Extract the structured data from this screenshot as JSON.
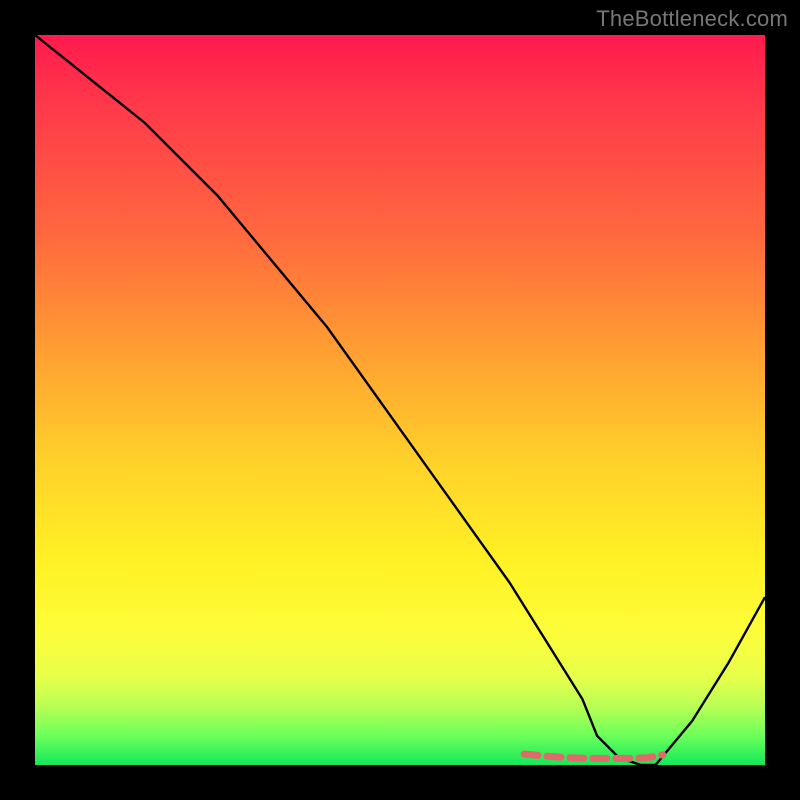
{
  "watermark": "TheBottleneck.com",
  "chart_data": {
    "type": "line",
    "title": "",
    "xlabel": "",
    "ylabel": "",
    "xlim": [
      0,
      100
    ],
    "ylim": [
      0,
      100
    ],
    "series": [
      {
        "name": "black-curve",
        "x": [
          0,
          5,
          10,
          15,
          20,
          25,
          30,
          35,
          40,
          45,
          50,
          55,
          60,
          65,
          70,
          75,
          77,
          80,
          83,
          85,
          90,
          95,
          100
        ],
        "y": [
          100,
          96,
          92,
          88,
          83,
          78,
          72,
          66,
          60,
          53,
          46,
          39,
          32,
          25,
          17,
          9,
          4,
          1,
          0,
          0,
          6,
          14,
          23
        ]
      },
      {
        "name": "red-bottom-segment",
        "x": [
          67,
          70,
          73,
          76,
          79,
          82,
          84,
          86
        ],
        "y": [
          1.5,
          1.2,
          1.0,
          0.9,
          0.9,
          0.9,
          1.0,
          1.4
        ]
      }
    ],
    "gradient_stops": [
      {
        "pos": 0,
        "color": "#ff1a4d"
      },
      {
        "pos": 28,
        "color": "#ff6a3e"
      },
      {
        "pos": 58,
        "color": "#ffd02a"
      },
      {
        "pos": 82,
        "color": "#fdfd3a"
      },
      {
        "pos": 100,
        "color": "#14e85a"
      }
    ]
  }
}
